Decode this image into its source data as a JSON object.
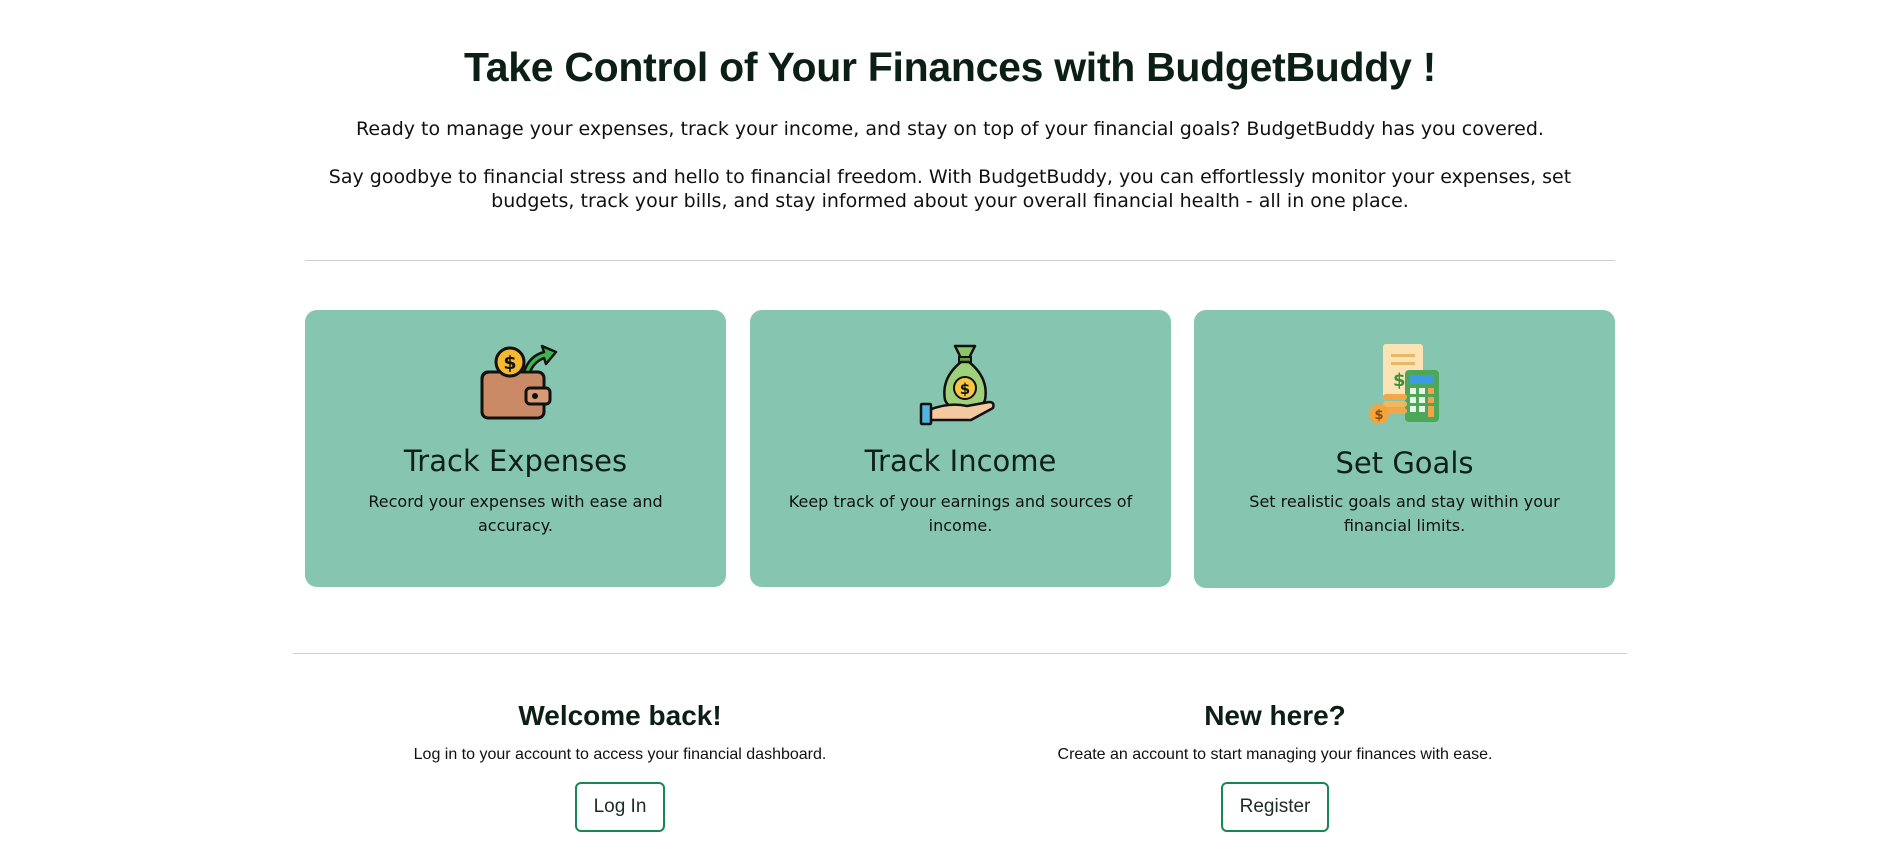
{
  "hero": {
    "title": "Take Control of Your Finances with BudgetBuddy !",
    "intro": "Ready to manage your expenses, track your income, and stay on top of your financial goals? BudgetBuddy has you covered.",
    "body": "Say goodbye to financial stress and hello to financial freedom. With BudgetBuddy, you can effortlessly monitor your expenses, set budgets, track your bills, and stay informed about your overall financial health - all in one place."
  },
  "features": [
    {
      "icon": "wallet-icon",
      "title": "Track Expenses",
      "description": "Record your expenses with ease and accuracy."
    },
    {
      "icon": "money-bag-hand-icon",
      "title": "Track Income",
      "description": "Keep track of your earnings and sources of income."
    },
    {
      "icon": "calculator-coins-icon",
      "title": "Set Goals",
      "description": "Set realistic goals and stay within your financial limits."
    }
  ],
  "login": {
    "heading": "Welcome back!",
    "text": "Log in to your account to access your financial dashboard.",
    "button": "Log In"
  },
  "register": {
    "heading": "New here?",
    "text": "Create an account to start managing your finances with ease.",
    "button": "Register"
  },
  "colors": {
    "card_background": "#86c5b0",
    "button_border": "#198754",
    "divider": "#cfcfcf"
  }
}
